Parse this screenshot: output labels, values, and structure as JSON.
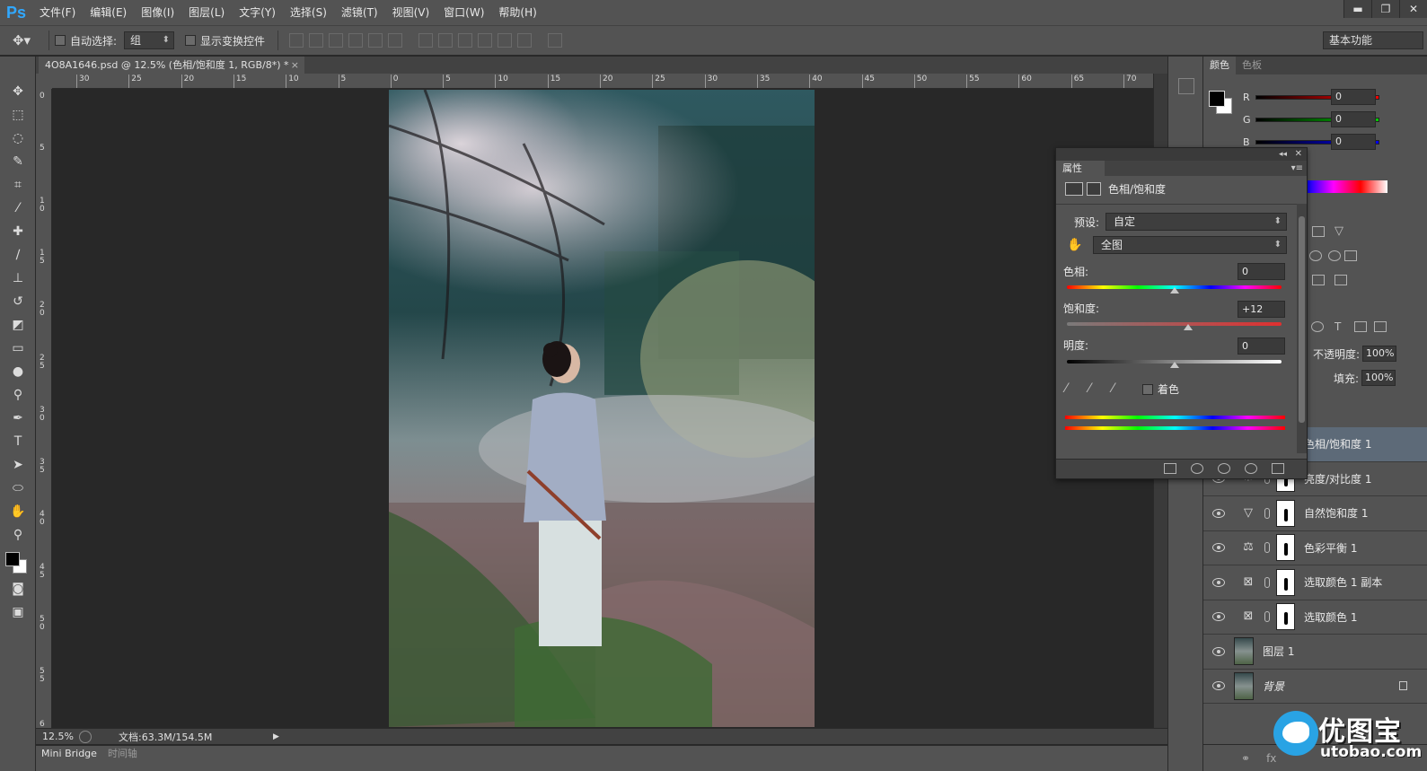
{
  "app": {
    "logo": "Ps"
  },
  "menu": [
    "文件(F)",
    "编辑(E)",
    "图像(I)",
    "图层(L)",
    "文字(Y)",
    "选择(S)",
    "滤镜(T)",
    "视图(V)",
    "窗口(W)",
    "帮助(H)"
  ],
  "options": {
    "auto_select_label": "自动选择:",
    "auto_select_value": "组",
    "show_transform_label": "显示变换控件",
    "workspace": "基本功能"
  },
  "document": {
    "tab_title": "4O8A1646.psd @ 12.5% (色相/饱和度 1, RGB/8*) *",
    "zoom": "12.5%",
    "doc_info": "文档:63.3M/154.5M",
    "ruler_top": [
      "30",
      "25",
      "20",
      "15",
      "10",
      "5",
      "0",
      "5",
      "10",
      "15",
      "20",
      "25",
      "30",
      "35",
      "40",
      "45",
      "50",
      "55",
      "60",
      "65",
      "70"
    ],
    "ruler_left": [
      "0",
      "5",
      "1\n0",
      "1\n5",
      "2\n0",
      "2\n5",
      "3\n0",
      "3\n5",
      "4\n0",
      "4\n5",
      "5\n0",
      "5\n5",
      "6"
    ]
  },
  "bottom_tabs": [
    "Mini Bridge",
    "时间轴"
  ],
  "color_panel": {
    "tabs": [
      "颜色",
      "色板"
    ],
    "channels": [
      {
        "label": "R",
        "value": "0",
        "color": "#ff0000"
      },
      {
        "label": "G",
        "value": "0",
        "color": "#00c000"
      },
      {
        "label": "B",
        "value": "0",
        "color": "#0000ff"
      }
    ]
  },
  "properties": {
    "tab": "属性",
    "heading": "色相/饱和度",
    "preset_label": "预设:",
    "preset_value": "自定",
    "channel_value": "全图",
    "hue_label": "色相:",
    "hue_value": "0",
    "saturation_label": "饱和度:",
    "saturation_value": "+12",
    "lightness_label": "明度:",
    "lightness_value": "0",
    "colorize_label": "着色"
  },
  "layers_panel": {
    "opacity_label": "不透明度:",
    "opacity_value": "100%",
    "fill_label": "填充:",
    "fill_value": "100%",
    "layers": [
      {
        "name": "色相/饱和度 1",
        "selected": true,
        "icon": "hue-sat-icon"
      },
      {
        "name": "亮度/对比度 1",
        "icon": "brightness-icon"
      },
      {
        "name": "自然饱和度 1",
        "icon": "vibrance-icon"
      },
      {
        "name": "色彩平衡 1",
        "icon": "balance-icon"
      },
      {
        "name": "选取颜色 1 副本",
        "icon": "selective-color-icon"
      },
      {
        "name": "选取颜色 1",
        "icon": "selective-color-icon"
      },
      {
        "name": "图层 1",
        "icon": "image-thumb"
      },
      {
        "name": "背景",
        "icon": "image-thumb"
      }
    ]
  },
  "watermark": {
    "cn": "优图宝",
    "en": "utobao.com"
  },
  "colors": {
    "accent": "#31a8ff",
    "panel": "#535353",
    "dark": "#282828",
    "selected": "#5d6a78"
  }
}
